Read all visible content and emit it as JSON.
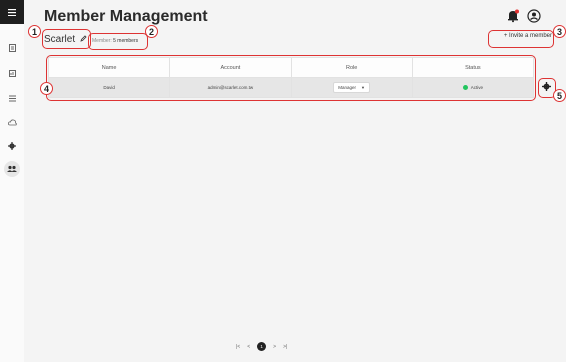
{
  "page": {
    "title": "Member Management"
  },
  "org": {
    "name": "Scarlet"
  },
  "member_count": {
    "label": "Member:",
    "value": "5 members"
  },
  "invite": {
    "label": "+ Invite a member"
  },
  "table": {
    "headers": [
      "Name",
      "Account",
      "Role",
      "Status"
    ],
    "rows": [
      {
        "name": "David",
        "account": "admin@scarlet.com.tw",
        "role": "Manager",
        "status": "Active"
      }
    ]
  },
  "status_colors": {
    "active": "#22c55e"
  },
  "pagination": {
    "first": "|<",
    "prev": "<",
    "current": "1",
    "next": ">",
    "last": ">|"
  },
  "callouts": [
    "1",
    "2",
    "3",
    "4",
    "5"
  ],
  "sidebar": {
    "icons": [
      "menu-icon",
      "document-icon",
      "chart-icon",
      "list-icon",
      "cloud-icon",
      "gear-icon",
      "users-icon"
    ]
  }
}
